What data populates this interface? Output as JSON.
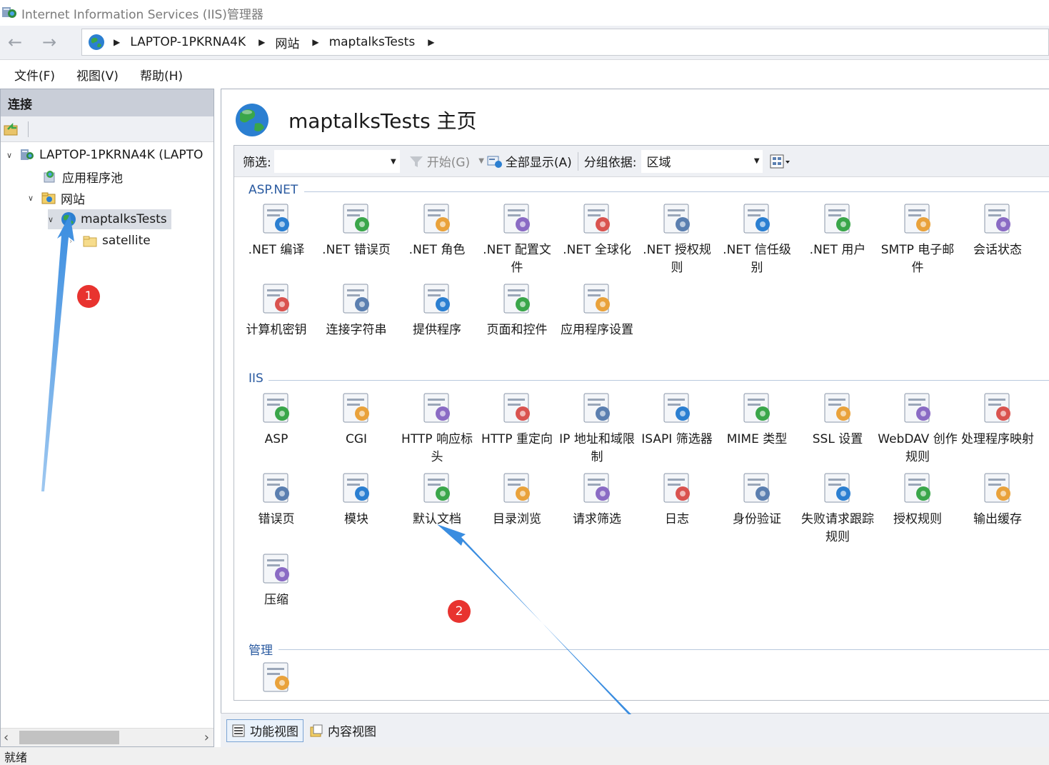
{
  "window": {
    "title": "Internet Information Services (IIS)管理器"
  },
  "address": {
    "crumbs": [
      "LAPTOP-1PKRNA4K",
      "网站",
      "maptalksTests"
    ]
  },
  "menu": [
    "文件(F)",
    "视图(V)",
    "帮助(H)"
  ],
  "connections": {
    "header": "连接",
    "tree": [
      {
        "label": "LAPTOP-1PKRNA4K (LAPTO",
        "level": 0,
        "expanded": true,
        "icon": "server-icon"
      },
      {
        "label": "应用程序池",
        "level": 1,
        "icon": "app-pool-icon"
      },
      {
        "label": "网站",
        "level": 1,
        "expanded": true,
        "icon": "sites-folder-icon"
      },
      {
        "label": "maptalksTests",
        "level": 2,
        "expanded": true,
        "selected": true,
        "icon": "globe-icon"
      },
      {
        "label": "satellite",
        "level": 3,
        "icon": "folder-icon"
      }
    ]
  },
  "page": {
    "title": "maptalksTests 主页"
  },
  "filterbar": {
    "filter_label": "筛选:",
    "go_label": "开始(G)",
    "show_all_label": "全部显示(A)",
    "group_label": "分组依据:",
    "group_value": "区域"
  },
  "sections": [
    {
      "title": "ASP.NET",
      "items": [
        {
          "label": ".NET 编译",
          "icon": "compile-icon"
        },
        {
          "label": ".NET 错误页",
          "icon": "error-404-icon"
        },
        {
          "label": ".NET 角色",
          "icon": "roles-icon"
        },
        {
          "label": ".NET 配置文件",
          "icon": "profile-icon"
        },
        {
          "label": ".NET 全球化",
          "icon": "globalization-icon"
        },
        {
          "label": ".NET 授权规则",
          "icon": "auth-rules-icon"
        },
        {
          "label": ".NET 信任级别",
          "icon": "trust-level-icon"
        },
        {
          "label": ".NET 用户",
          "icon": "users-icon"
        },
        {
          "label": "SMTP 电子邮件",
          "icon": "smtp-icon"
        },
        {
          "label": "会话状态",
          "icon": "session-icon"
        },
        {
          "label": "计算机密钥",
          "icon": "machine-key-icon"
        },
        {
          "label": "连接字符串",
          "icon": "connection-string-icon"
        },
        {
          "label": "提供程序",
          "icon": "providers-icon"
        },
        {
          "label": "页面和控件",
          "icon": "pages-controls-icon"
        },
        {
          "label": "应用程序设置",
          "icon": "app-settings-icon"
        }
      ]
    },
    {
      "title": "IIS",
      "items": [
        {
          "label": "ASP",
          "icon": "asp-icon"
        },
        {
          "label": "CGI",
          "icon": "cgi-icon"
        },
        {
          "label": "HTTP 响应标头",
          "icon": "http-headers-icon"
        },
        {
          "label": "HTTP 重定向",
          "icon": "http-redirect-icon"
        },
        {
          "label": "IP 地址和域限制",
          "icon": "ip-restrict-icon"
        },
        {
          "label": "ISAPI 筛选器",
          "icon": "isapi-icon"
        },
        {
          "label": "MIME 类型",
          "icon": "mime-icon"
        },
        {
          "label": "SSL 设置",
          "icon": "ssl-lock-icon"
        },
        {
          "label": "WebDAV 创作规则",
          "icon": "webdav-icon"
        },
        {
          "label": "处理程序映射",
          "icon": "handler-mappings-icon"
        },
        {
          "label": "错误页",
          "icon": "error-pages-icon"
        },
        {
          "label": "模块",
          "icon": "modules-icon"
        },
        {
          "label": "默认文档",
          "icon": "default-document-icon"
        },
        {
          "label": "目录浏览",
          "icon": "directory-browsing-icon"
        },
        {
          "label": "请求筛选",
          "icon": "request-filtering-icon"
        },
        {
          "label": "日志",
          "icon": "logging-icon"
        },
        {
          "label": "身份验证",
          "icon": "authentication-icon"
        },
        {
          "label": "失败请求跟踪规则",
          "icon": "failed-request-icon"
        },
        {
          "label": "授权规则",
          "icon": "authorization-icon"
        },
        {
          "label": "输出缓存",
          "icon": "output-cache-icon"
        },
        {
          "label": "压缩",
          "icon": "compression-icon"
        }
      ]
    },
    {
      "title": "管理",
      "items": [
        {
          "label": "",
          "icon": "config-editor-icon"
        }
      ]
    }
  ],
  "bottom_tabs": {
    "features": "功能视图",
    "content": "内容视图"
  },
  "status": {
    "text": "就绪"
  },
  "annotations": {
    "badge1": "1",
    "badge2": "2",
    "arrow_color": "#3a8de0",
    "badge_color": "#e8332f"
  }
}
